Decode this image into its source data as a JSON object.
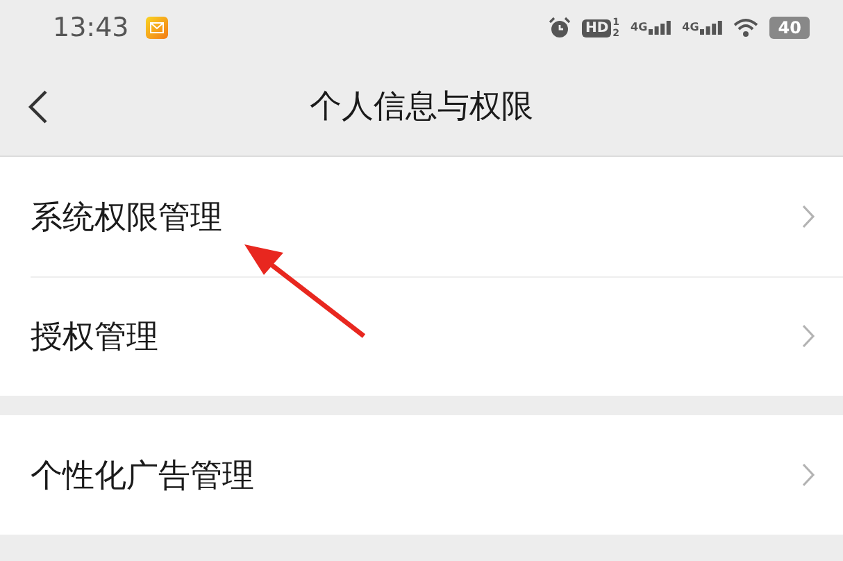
{
  "status_bar": {
    "time": "13:43",
    "hd": "HD",
    "sim_1": "1",
    "sim_2": "2",
    "network_1": "4G",
    "network_2": "4G",
    "battery": "40"
  },
  "header": {
    "title": "个人信息与权限"
  },
  "sections": [
    {
      "items": [
        {
          "label": "系统权限管理"
        },
        {
          "label": "授权管理"
        }
      ]
    },
    {
      "items": [
        {
          "label": "个性化广告管理"
        }
      ]
    }
  ]
}
